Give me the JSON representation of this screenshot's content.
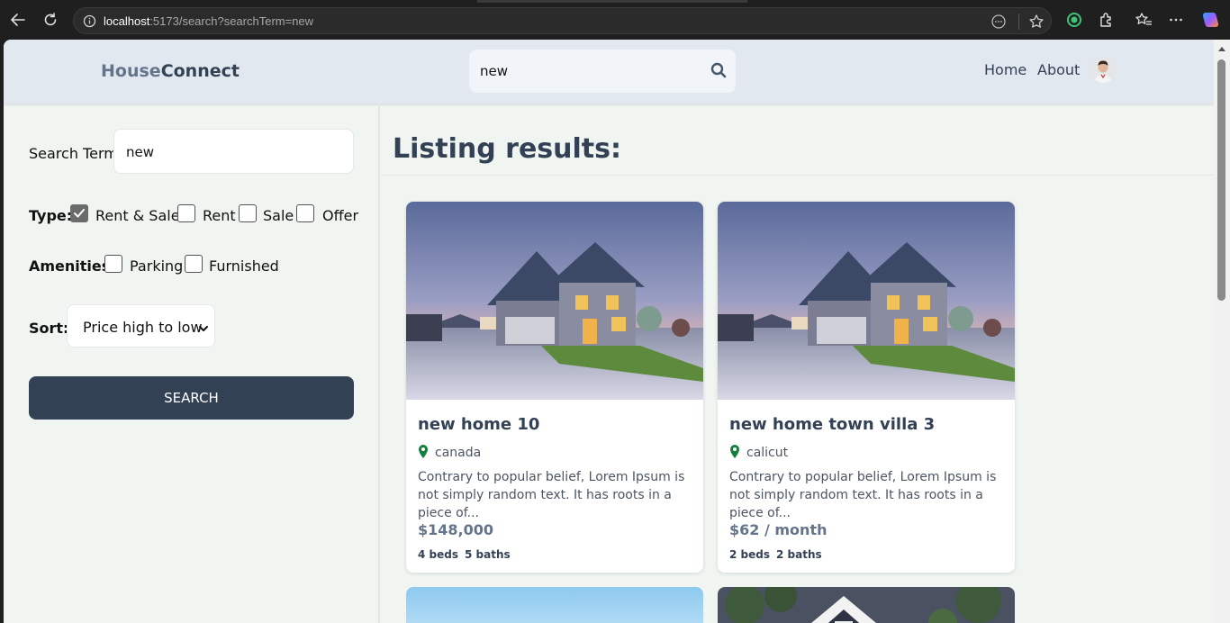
{
  "browser": {
    "url_host": "localhost",
    "url_rest": ":5173/search?searchTerm=new",
    "icons": [
      "back-icon",
      "refresh-icon",
      "info-icon",
      "reader-icon",
      "favorite-icon",
      "extension-icon",
      "favorites-icon",
      "more-icon",
      "copilot-icon"
    ]
  },
  "header": {
    "brand_part1": "House",
    "brand_part2": "Connect",
    "search_value": "new",
    "nav": [
      "Home",
      "About"
    ]
  },
  "sidebar": {
    "search_label": "Search Term",
    "search_value": "new",
    "type_label": "Type:",
    "type_options": [
      {
        "label": "Rent & Sale",
        "checked": true
      },
      {
        "label": "Rent",
        "checked": false
      },
      {
        "label": "Sale",
        "checked": false
      },
      {
        "label": "Offer",
        "checked": false
      }
    ],
    "amenities_label": "Amenities:",
    "amenities": [
      {
        "label": "Parking",
        "checked": false
      },
      {
        "label": "Furnished",
        "checked": false
      }
    ],
    "sort_label": "Sort:",
    "sort_value": "Price high to low",
    "search_button": "SEARCH"
  },
  "results": {
    "title": "Listing results:",
    "listings": [
      {
        "title": "new home 10",
        "location": "canada",
        "description": "Contrary to popular belief, Lorem Ipsum is not simply random text. It has roots in a piece of...",
        "price": "$148,000",
        "beds": "4 beds",
        "baths": "5 baths"
      },
      {
        "title": "new home town villa 3",
        "location": "calicut",
        "description": "Contrary to popular belief, Lorem Ipsum is not simply random text. It has roots in a piece of...",
        "price": "$62 / month",
        "beds": "2 beds",
        "baths": "2 baths"
      }
    ]
  },
  "colors": {
    "header_bg": "#e2e8f0",
    "page_bg": "#f1f5f1",
    "button_bg": "#334155",
    "location_pin": "#15803d"
  }
}
